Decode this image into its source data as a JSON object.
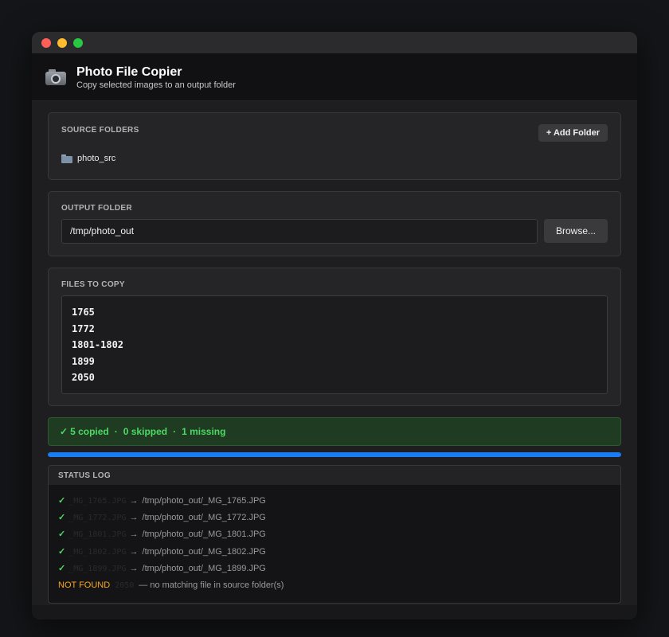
{
  "window": {
    "colors": {
      "close": "#ff5f57",
      "minimize": "#febc2e",
      "maximize": "#28c840"
    }
  },
  "header": {
    "icon": "camera-icon",
    "title": "Photo File Copier",
    "subtitle": "Copy selected images to an output folder"
  },
  "source": {
    "label": "SOURCE FOLDERS",
    "add_button": "+ Add Folder",
    "folders": [
      {
        "icon": "folder-icon",
        "name": "photo_src"
      }
    ]
  },
  "output": {
    "label": "OUTPUT FOLDER",
    "value": "/tmp/photo_out",
    "browse_button": "Browse..."
  },
  "files": {
    "label": "FILES TO COPY",
    "lines": [
      "1765",
      "1772",
      "1801-1802",
      "1899",
      "2050"
    ]
  },
  "summary": {
    "check": "✓",
    "copied": "5 copied",
    "skipped": "0 skipped",
    "missing": "1 missing",
    "separator": "·",
    "color": "#4cd964"
  },
  "progress": {
    "percent": 100,
    "color": "#1a7cf2"
  },
  "log": {
    "label": "STATUS LOG",
    "entries": [
      {
        "mark": "✓",
        "src": "_MG_1765.JPG",
        "arrow": "→",
        "dest": "/tmp/photo_out/_MG_1765.JPG"
      },
      {
        "mark": "✓",
        "src": "_MG_1772.JPG",
        "arrow": "→",
        "dest": "/tmp/photo_out/_MG_1772.JPG"
      },
      {
        "mark": "✓",
        "src": "_MG_1801.JPG",
        "arrow": "→",
        "dest": "/tmp/photo_out/_MG_1801.JPG"
      },
      {
        "mark": "✓",
        "src": "_MG_1802.JPG",
        "arrow": "→",
        "dest": "/tmp/photo_out/_MG_1802.JPG"
      },
      {
        "mark": "✓",
        "src": "_MG_1899.JPG",
        "arrow": "→",
        "dest": "/tmp/photo_out/_MG_1899.JPG"
      }
    ],
    "not_found": {
      "status": "NOT FOUND",
      "number": "2050",
      "message": "— no matching file in source folder(s)"
    }
  }
}
